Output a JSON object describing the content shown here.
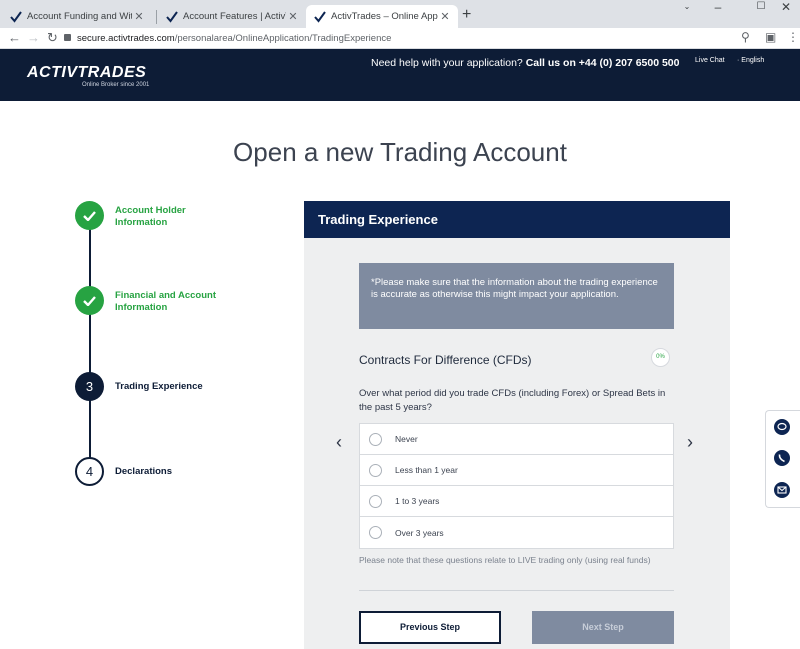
{
  "browser": {
    "tabs": [
      {
        "title": "Account Funding and Withdrawal"
      },
      {
        "title": "Account Features | ActivTrades"
      },
      {
        "title": "ActivTrades – Online Application"
      }
    ],
    "url": {
      "host": "secure.activtrades.com",
      "path": "/personalarea/OnlineApplication/TradingExperience"
    }
  },
  "header": {
    "logo": "ACTIVTRADES",
    "logo_tagline": "Online Broker since 2001",
    "help_text": "Need help with your application?",
    "help_phone": "Call us on +44 (0) 207 6500 500",
    "live_chat": "Live Chat",
    "language": "English"
  },
  "page": {
    "title": "Open a new Trading Account"
  },
  "steps": [
    {
      "number": "1",
      "label_line1": "Account Holder",
      "label_line2": "Information",
      "state": "done"
    },
    {
      "number": "2",
      "label_line1": "Financial and Account",
      "label_line2": "Information",
      "state": "done"
    },
    {
      "number": "3",
      "label_line1": "Trading Experience",
      "label_line2": "",
      "state": "current"
    },
    {
      "number": "4",
      "label_line1": "Declarations",
      "label_line2": "",
      "state": "todo"
    }
  ],
  "panel": {
    "title": "Trading Experience",
    "notice": "*Please make sure that the information about the trading experience is accurate as otherwise this might impact your application.",
    "section_title": "Contracts For Difference (CFDs)",
    "progress": "0%",
    "question": "Over what period did you trade CFDs (including Forex) or Spread Bets in the past 5 years?",
    "options": [
      "Never",
      "Less than 1 year",
      "1 to 3 years",
      "Over 3 years"
    ],
    "note": "Please note that these questions relate to LIVE trading only (using real funds)",
    "prev_button": "Previous Step",
    "next_button": "Next Step"
  },
  "colors": {
    "navy": "#0d1c36",
    "panel_header": "#0d2552",
    "green": "#27a342",
    "notice_bg": "#7f8ba0"
  },
  "icons": [
    "chat-icon",
    "phone-icon",
    "mail-icon"
  ]
}
